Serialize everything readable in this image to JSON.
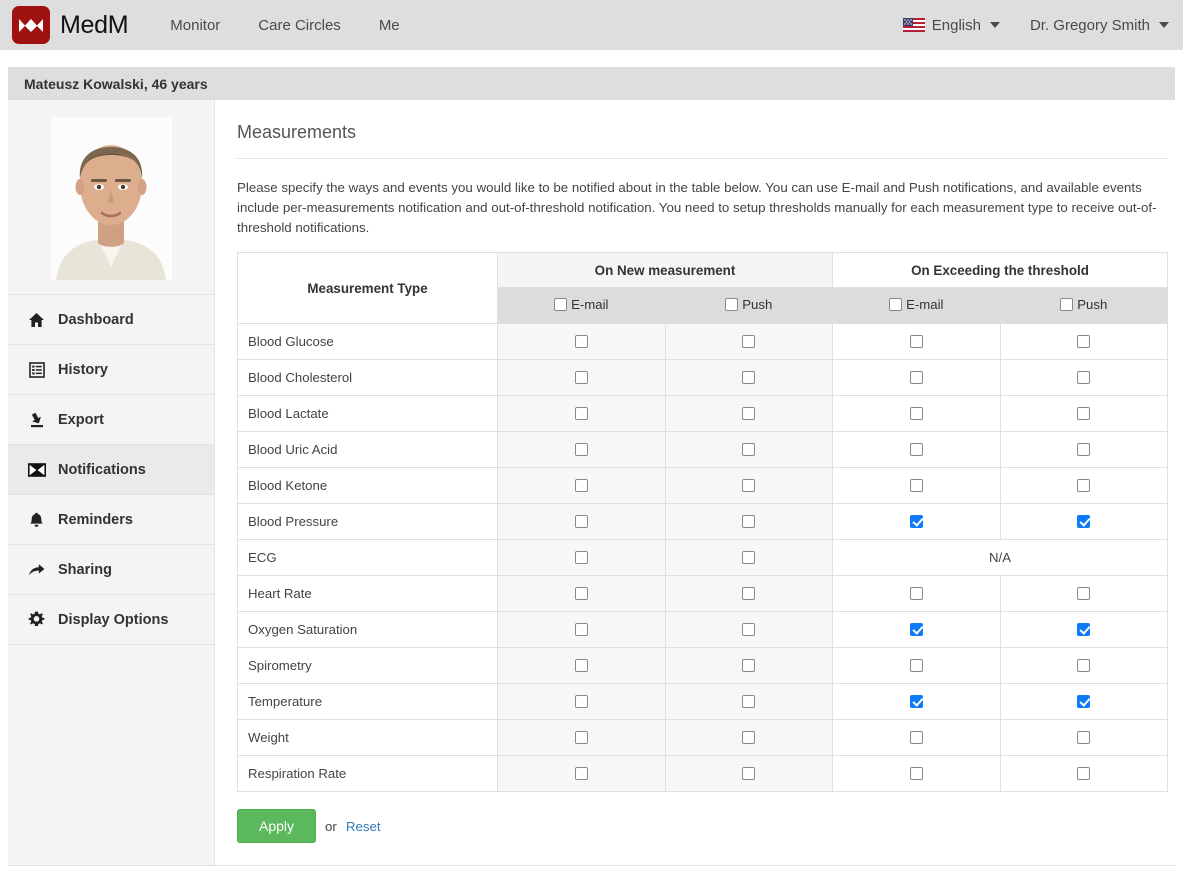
{
  "topnav": {
    "brand": "MedM",
    "logo_color": "#a01111",
    "links": [
      "Monitor",
      "Care Circles",
      "Me"
    ],
    "language": "English",
    "user": "Dr. Gregory Smith"
  },
  "patient": {
    "name_age": "Mateusz Kowalski, 46 years"
  },
  "sidebar": {
    "items": [
      {
        "label": "Dashboard",
        "icon": "home-icon",
        "active": false
      },
      {
        "label": "History",
        "icon": "list-icon",
        "active": false
      },
      {
        "label": "Export",
        "icon": "export-icon",
        "active": false
      },
      {
        "label": "Notifications",
        "icon": "envelope-icon",
        "active": true
      },
      {
        "label": "Reminders",
        "icon": "bell-icon",
        "active": false
      },
      {
        "label": "Sharing",
        "icon": "arrow-icon",
        "active": false
      },
      {
        "label": "Display Options",
        "icon": "gear-icon",
        "active": false
      }
    ]
  },
  "main": {
    "title": "Measurements",
    "description": "Please specify the ways and events you would like to be notified about in the table below. You can use E-mail and Push notifications, and available events include per-measurements notification and out-of-threshold notification. You need to setup thresholds manually for each measurement type to receive out-of-threshold notifications.",
    "table": {
      "type_header": "Measurement Type",
      "group_headers": [
        "On New measurement",
        "On Exceeding the threshold"
      ],
      "sub_headers": [
        "E-mail",
        "Push",
        "E-mail",
        "Push"
      ],
      "header_checkboxes": [
        false,
        false,
        false,
        false
      ],
      "na_label": "N/A",
      "rows": [
        {
          "type": "Blood Glucose",
          "new_email": false,
          "new_push": false,
          "thr_email": false,
          "thr_push": false,
          "thr_na": false
        },
        {
          "type": "Blood Cholesterol",
          "new_email": false,
          "new_push": false,
          "thr_email": false,
          "thr_push": false,
          "thr_na": false
        },
        {
          "type": "Blood Lactate",
          "new_email": false,
          "new_push": false,
          "thr_email": false,
          "thr_push": false,
          "thr_na": false
        },
        {
          "type": "Blood Uric Acid",
          "new_email": false,
          "new_push": false,
          "thr_email": false,
          "thr_push": false,
          "thr_na": false
        },
        {
          "type": "Blood Ketone",
          "new_email": false,
          "new_push": false,
          "thr_email": false,
          "thr_push": false,
          "thr_na": false
        },
        {
          "type": "Blood Pressure",
          "new_email": false,
          "new_push": false,
          "thr_email": true,
          "thr_push": true,
          "thr_na": false
        },
        {
          "type": "ECG",
          "new_email": false,
          "new_push": false,
          "thr_email": false,
          "thr_push": false,
          "thr_na": true
        },
        {
          "type": "Heart Rate",
          "new_email": false,
          "new_push": false,
          "thr_email": false,
          "thr_push": false,
          "thr_na": false
        },
        {
          "type": "Oxygen Saturation",
          "new_email": false,
          "new_push": false,
          "thr_email": true,
          "thr_push": true,
          "thr_na": false
        },
        {
          "type": "Spirometry",
          "new_email": false,
          "new_push": false,
          "thr_email": false,
          "thr_push": false,
          "thr_na": false
        },
        {
          "type": "Temperature",
          "new_email": false,
          "new_push": false,
          "thr_email": true,
          "thr_push": true,
          "thr_na": false
        },
        {
          "type": "Weight",
          "new_email": false,
          "new_push": false,
          "thr_email": false,
          "thr_push": false,
          "thr_na": false
        },
        {
          "type": "Respiration Rate",
          "new_email": false,
          "new_push": false,
          "thr_email": false,
          "thr_push": false,
          "thr_na": false
        }
      ]
    },
    "actions": {
      "apply_label": "Apply",
      "or_label": "or",
      "reset_label": "Reset",
      "apply_color": "#5cb85c",
      "reset_color": "#337ab7"
    }
  }
}
